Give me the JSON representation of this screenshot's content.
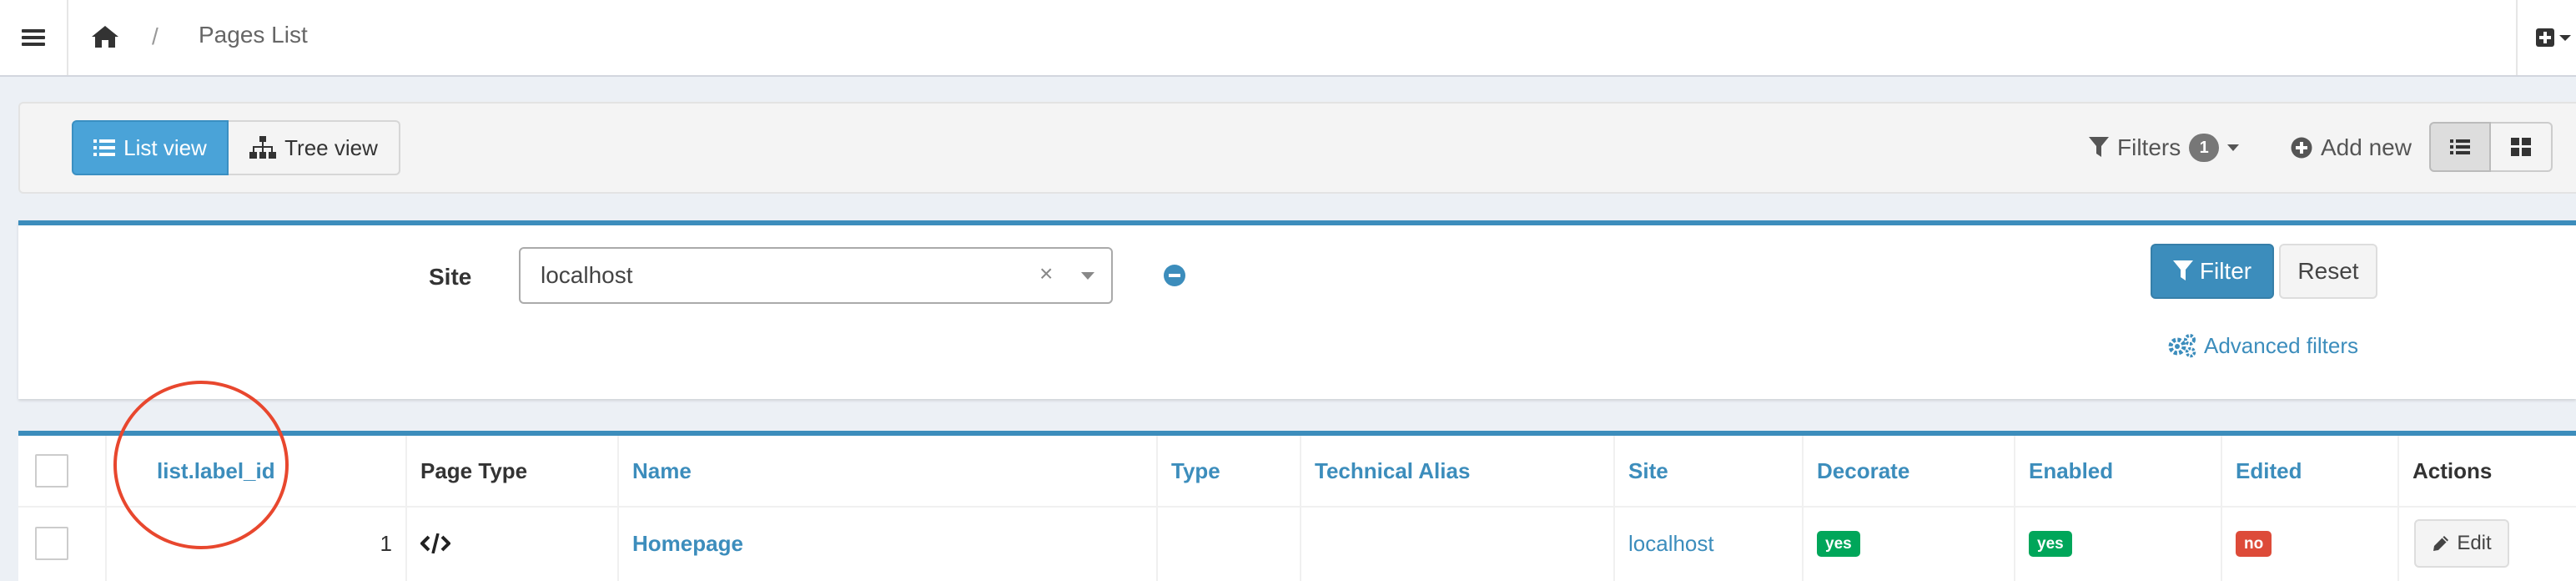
{
  "header": {
    "menu_icon": "hamburger-icon",
    "home_icon": "home-icon",
    "breadcrumb_separator": "/",
    "breadcrumb_current": "Pages List",
    "add_icon": "plus-square-icon"
  },
  "view_toolbar": {
    "list_view_label": "List view",
    "tree_view_label": "Tree view",
    "filters_label": "Filters",
    "filters_count": "1",
    "add_new_label": "Add new"
  },
  "filters": {
    "site_label": "Site",
    "site_value": "localhost",
    "clear_symbol": "×",
    "filter_button": "Filter",
    "reset_button": "Reset",
    "advanced_filters": "Advanced filters"
  },
  "table": {
    "headers": {
      "id": "list.label_id",
      "page_type": "Page Type",
      "name": "Name",
      "type": "Type",
      "technical_alias": "Technical Alias",
      "site": "Site",
      "decorate": "Decorate",
      "enabled": "Enabled",
      "edited": "Edited",
      "actions": "Actions"
    },
    "rows": [
      {
        "id": "1",
        "page_type_icon": "code-icon",
        "name": "Homepage",
        "type": "",
        "technical_alias": "",
        "site": "localhost",
        "decorate": "yes",
        "enabled": "yes",
        "edited": "no",
        "edit_label": "Edit"
      }
    ]
  },
  "colors": {
    "accent": "#3c8dbc",
    "active_button": "#4aa3d8",
    "badge_yes": "#00a65a",
    "badge_no": "#dd4b39",
    "annotation": "#e8472e"
  }
}
